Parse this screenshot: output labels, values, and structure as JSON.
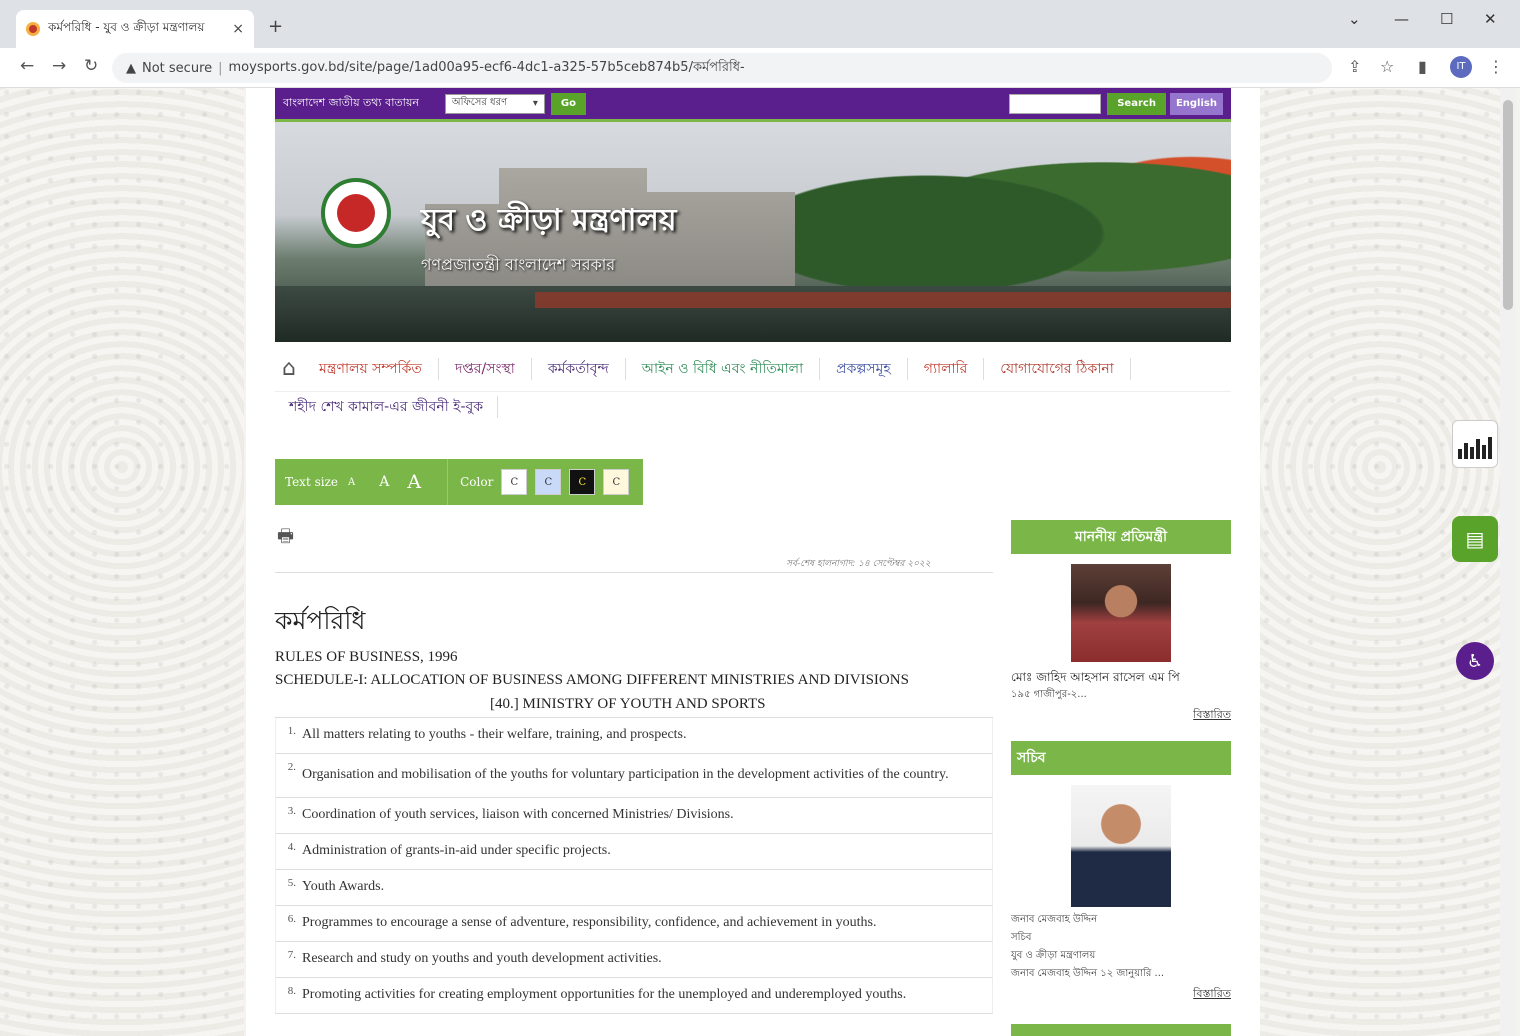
{
  "browser": {
    "tab_title": "কর্মপরিধি - যুব ও ক্রীড়া মন্ত্রণালয়",
    "tab_close": "×",
    "new_tab": "+",
    "security": "Not secure",
    "url": "moysports.gov.bd/site/page/1ad00a95-ecf6-4dc1-a325-57b5ceb874b5/কর্মপরিধি-",
    "profile_initial": "IT"
  },
  "topbar": {
    "portal_label": "বাংলাদেশ জাতীয় তথ্য বাতায়ন",
    "office_select": "অফিসের ধরণ",
    "go_label": "Go",
    "search_label": "Search",
    "english_label": "English"
  },
  "banner": {
    "ministry_name": "যুব ও ক্রীড়া মন্ত্রণালয়",
    "govt_name": "গণপ্রজাতন্ত্রী বাংলাদেশ সরকার"
  },
  "menu": {
    "items": [
      "মন্ত্রণালয় সম্পর্কিত",
      "দপ্তর/সংস্থা",
      "কর্মকর্তাবৃন্দ",
      "আইন ও বিধি এবং নীতিমালা",
      "প্রকল্পসমূহ",
      "গ্যালারি",
      "যোগাযোগের ঠিকানা"
    ],
    "second_row": "শহীদ শেখ কামাল-এর জীবনী ই-বুক"
  },
  "accessibility": {
    "text_size_label": "Text size",
    "size_small": "A",
    "size_medium": "A",
    "size_large": "A",
    "color_label": "Color",
    "color_options": [
      "C",
      "C",
      "C",
      "C"
    ]
  },
  "content": {
    "last_updated": "সর্ব-শেষ হালনাগাদ: ১৪ সেপ্টেম্বর ২০২২",
    "title": "কর্মপরিধি",
    "line1": "RULES OF BUSINESS, 1996",
    "line2": "SCHEDULE-I: ALLOCATION OF BUSINESS AMONG DIFFERENT MINISTRIES AND DIVISIONS",
    "line3": "[40.] MINISTRY OF YOUTH AND SPORTS",
    "items": [
      {
        "n": "1.",
        "text": "All matters relating to youths - their welfare, training, and prospects."
      },
      {
        "n": "2.",
        "text": "Organisation and mobilisation of the youths for voluntary participation in the development activities of the country."
      },
      {
        "n": "3.",
        "text": "Coordination of youth services, liaison with concerned Ministries/ Divisions."
      },
      {
        "n": "4.",
        "text": "Administration of grants-in-aid under specific projects."
      },
      {
        "n": "5.",
        "text": "Youth Awards."
      },
      {
        "n": "6.",
        "text": "Programmes to encourage a sense of adventure, responsibility, confidence, and achievement in youths."
      },
      {
        "n": "7.",
        "text": "Research and study on youths and youth development activities."
      },
      {
        "n": "8.",
        "text": "Promoting activities for creating employment opportunities for the unemployed and underemployed youths."
      }
    ]
  },
  "sidebar": {
    "minister_header": "মাননীয় প্রতিমন্ত্রী",
    "minister_name": "মোঃ জাহিদ আহসান রাসেল এম পি",
    "minister_sub": "১৯৫ গাজীপুর-২...",
    "minister_more": "বিস্তারিত",
    "secretary_header": "সচিব",
    "secretary_name": "জনাব মেজবাহ উদ্দিন",
    "secretary_title": "সচিব",
    "secretary_ministry": "যুব ও ক্রীড়া মন্ত্রণালয়",
    "secretary_sub": "জনাব মেজবাহ উদ্দিন ১২ জানুয়ারি ...",
    "secretary_more": "বিস্তারিত"
  },
  "icons": [
    "warning-icon",
    "home-icon",
    "print-icon",
    "chart-icon",
    "chat-icon",
    "accessibility-icon"
  ]
}
